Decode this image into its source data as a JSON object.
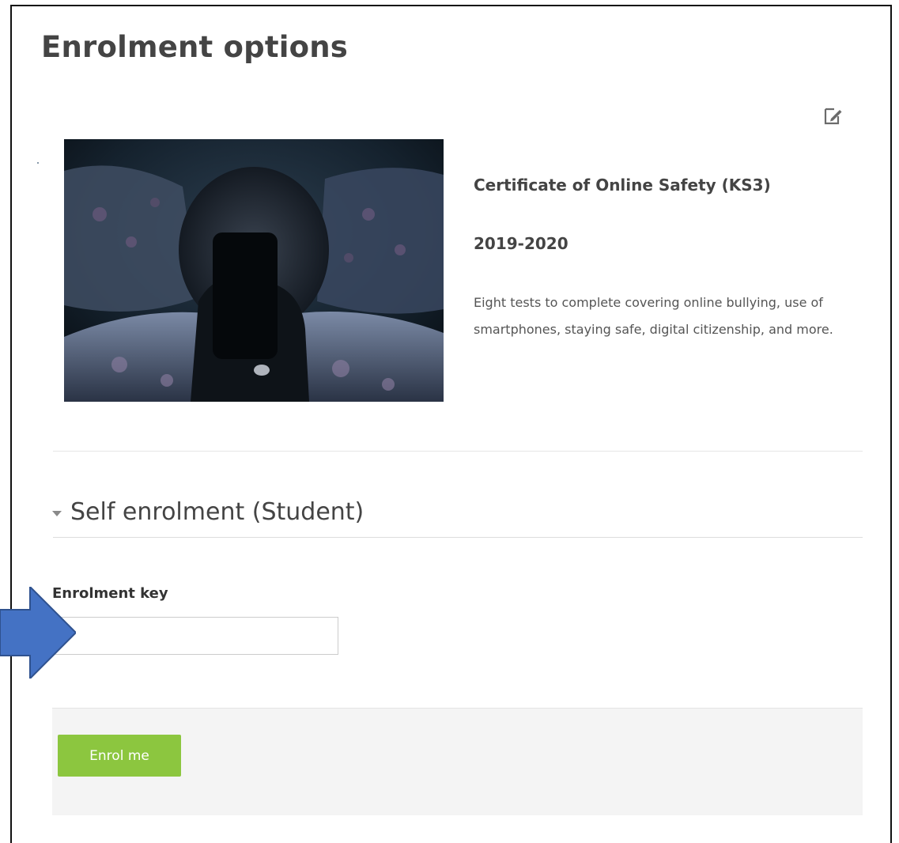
{
  "page": {
    "title": "Enrolment options"
  },
  "toolbar": {
    "edit_icon": "edit-settings-icon"
  },
  "course": {
    "image_icon": "course-image-person-with-phone-in-bed",
    "name": "Certificate of Online Safety (KS3)",
    "year": "2019-2020",
    "summary": "Eight tests to complete covering online bullying, use of smartphones, staying safe, digital citizenship, and more."
  },
  "self_enrolment": {
    "section_title": "Self enrolment (Student)",
    "caret_icon": "caret-down-icon",
    "key_label": "Enrolment key",
    "key_value": "",
    "key_placeholder": "",
    "pointer_icon": "arrow-right-icon",
    "submit_label": "Enrol me"
  },
  "colors": {
    "accent_button": "#8cc63f",
    "pointer_arrow": "#4472c4",
    "footer_background": "#f4f4f4"
  }
}
